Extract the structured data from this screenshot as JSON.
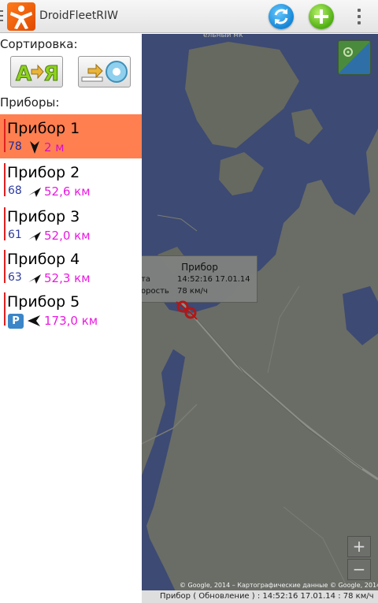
{
  "app": {
    "title": "DroidFleetRIW",
    "actions": [
      "refresh-icon",
      "add-icon",
      "overflow-menu-icon"
    ]
  },
  "sidebar": {
    "sort_label": "Сортировка:",
    "sort_buttons": [
      "sort-alphabetical-icon",
      "sort-by-distance-icon"
    ],
    "devices_label": "Приборы:",
    "devices": [
      {
        "name": "Прибор 1",
        "speed": "78",
        "distance": "2 м",
        "direction": "direction-arrow-icon",
        "selected": true
      },
      {
        "name": "Прибор 2",
        "speed": "68",
        "distance": "52,6 км",
        "direction": "direction-arrow-icon",
        "selected": false
      },
      {
        "name": "Прибор 3",
        "speed": "61",
        "distance": "52,0 км",
        "direction": "direction-arrow-icon",
        "selected": false
      },
      {
        "name": "Прибор 4",
        "speed": "63",
        "distance": "52,3 км",
        "direction": "direction-arrow-icon",
        "selected": false
      },
      {
        "name": "Прибор 5",
        "speed": "",
        "status_icon": "parking-icon",
        "parking_label": "P",
        "distance": "173,0 км",
        "direction": "direction-arrow-icon",
        "selected": false
      }
    ]
  },
  "map": {
    "partial_label": "ельный мк",
    "popup": {
      "title": "Прибор",
      "rows": [
        {
          "key": "та",
          "value": "14:52:16 17.01.14"
        },
        {
          "key": "орость",
          "value": "78 км/ч"
        }
      ]
    },
    "zoom_in": "+",
    "zoom_out": "−",
    "attribution": "© Google, 2014 – Картографические данные © Google, 2014",
    "status": {
      "name": "Прибор",
      "mode": "( Обновление )",
      "details": ": 14:52:16 17.01.14 : 78 км/ч"
    }
  },
  "colors": {
    "selected_row": "#ff7f50",
    "speed_text": "#2c3a9e",
    "distance_text": "#e91ae0",
    "row_bar": "#e02020",
    "map_water": "#3d4a73",
    "map_land": "#6a6d66"
  }
}
